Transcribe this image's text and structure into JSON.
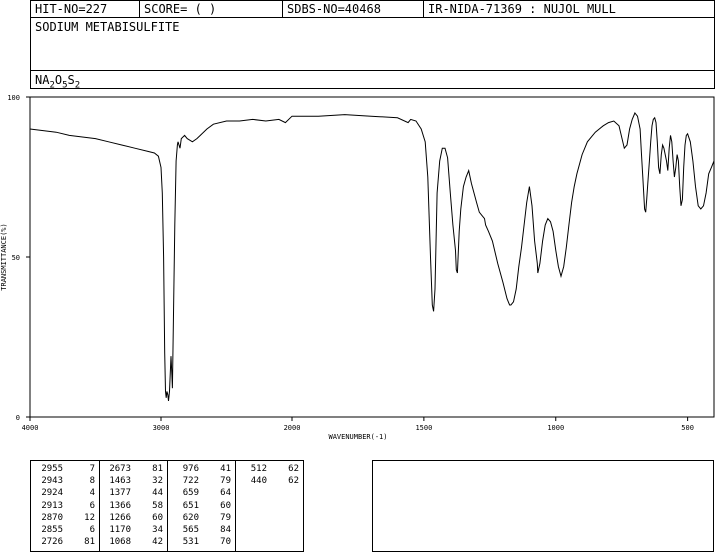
{
  "header": {
    "hit_no": "HIT-NO=227",
    "score": "SCORE=  (   )",
    "sdbs_no": "SDBS-NO=40468",
    "ir_nida": "IR-NIDA-71369 : NUJOL MULL"
  },
  "compound": {
    "name": "SODIUM METABISULFITE",
    "formula_parts": [
      "NA",
      "2",
      "O",
      "5",
      "S",
      "2"
    ]
  },
  "chart_data": {
    "type": "line",
    "xlabel": "WAVENUMBER(-1)",
    "ylabel": "TRANSMITTANCE(%)",
    "xlim": [
      4000,
      400
    ],
    "ylim": [
      0,
      100
    ],
    "x_ticks": [
      "4000",
      "3000",
      "2000",
      "1500",
      "1000",
      "500"
    ],
    "y_ticks": [
      "100",
      "50",
      "0"
    ],
    "grid": false,
    "series": [
      {
        "points": [
          [
            4000,
            90
          ],
          [
            3900,
            89.5
          ],
          [
            3800,
            89
          ],
          [
            3700,
            88
          ],
          [
            3600,
            87.5
          ],
          [
            3500,
            87
          ],
          [
            3400,
            86
          ],
          [
            3300,
            85
          ],
          [
            3200,
            84
          ],
          [
            3100,
            83
          ],
          [
            3050,
            82.5
          ],
          [
            3020,
            81.5
          ],
          [
            3000,
            78
          ],
          [
            2990,
            70
          ],
          [
            2980,
            50
          ],
          [
            2972,
            20
          ],
          [
            2966,
            8
          ],
          [
            2960,
            6
          ],
          [
            2955,
            8
          ],
          [
            2948,
            7
          ],
          [
            2943,
            5
          ],
          [
            2935,
            8
          ],
          [
            2924,
            19
          ],
          [
            2917,
            13
          ],
          [
            2913,
            9
          ],
          [
            2905,
            30
          ],
          [
            2895,
            60
          ],
          [
            2885,
            80
          ],
          [
            2875,
            85
          ],
          [
            2870,
            86
          ],
          [
            2855,
            84
          ],
          [
            2845,
            87
          ],
          [
            2820,
            88
          ],
          [
            2800,
            87
          ],
          [
            2760,
            86
          ],
          [
            2726,
            87
          ],
          [
            2700,
            88
          ],
          [
            2650,
            90
          ],
          [
            2600,
            91.5
          ],
          [
            2500,
            92.5
          ],
          [
            2400,
            92.5
          ],
          [
            2300,
            93
          ],
          [
            2200,
            92.5
          ],
          [
            2100,
            93
          ],
          [
            2050,
            92
          ],
          [
            2000,
            94
          ],
          [
            1900,
            94
          ],
          [
            1800,
            94.5
          ],
          [
            1700,
            94
          ],
          [
            1600,
            93.5
          ],
          [
            1560,
            92
          ],
          [
            1550,
            93
          ],
          [
            1530,
            92.5
          ],
          [
            1510,
            90
          ],
          [
            1495,
            86
          ],
          [
            1485,
            75
          ],
          [
            1475,
            50
          ],
          [
            1468,
            35
          ],
          [
            1463,
            33
          ],
          [
            1458,
            40
          ],
          [
            1450,
            70
          ],
          [
            1440,
            80
          ],
          [
            1430,
            84
          ],
          [
            1420,
            84
          ],
          [
            1410,
            81
          ],
          [
            1400,
            70
          ],
          [
            1390,
            60
          ],
          [
            1380,
            52
          ],
          [
            1377,
            46
          ],
          [
            1373,
            45
          ],
          [
            1366,
            58
          ],
          [
            1360,
            65
          ],
          [
            1350,
            72
          ],
          [
            1340,
            75
          ],
          [
            1330,
            77
          ],
          [
            1320,
            73
          ],
          [
            1310,
            70
          ],
          [
            1300,
            67
          ],
          [
            1290,
            64
          ],
          [
            1280,
            63
          ],
          [
            1270,
            62
          ],
          [
            1266,
            60
          ],
          [
            1255,
            58
          ],
          [
            1240,
            55
          ],
          [
            1220,
            48
          ],
          [
            1200,
            42
          ],
          [
            1185,
            37
          ],
          [
            1175,
            35
          ],
          [
            1170,
            35
          ],
          [
            1160,
            36
          ],
          [
            1150,
            40
          ],
          [
            1140,
            47
          ],
          [
            1130,
            53
          ],
          [
            1120,
            60
          ],
          [
            1110,
            67
          ],
          [
            1100,
            72
          ],
          [
            1090,
            66
          ],
          [
            1080,
            55
          ],
          [
            1070,
            48
          ],
          [
            1068,
            45
          ],
          [
            1060,
            48
          ],
          [
            1050,
            55
          ],
          [
            1040,
            60
          ],
          [
            1030,
            62
          ],
          [
            1020,
            61
          ],
          [
            1010,
            58
          ],
          [
            1000,
            52
          ],
          [
            990,
            47
          ],
          [
            980,
            44
          ],
          [
            970,
            47
          ],
          [
            960,
            53
          ],
          [
            950,
            60
          ],
          [
            940,
            67
          ],
          [
            930,
            72
          ],
          [
            920,
            76
          ],
          [
            900,
            82
          ],
          [
            880,
            86
          ],
          [
            850,
            89
          ],
          [
            820,
            91
          ],
          [
            800,
            92
          ],
          [
            780,
            92.5
          ],
          [
            760,
            91
          ],
          [
            740,
            84
          ],
          [
            730,
            85
          ],
          [
            720,
            90
          ],
          [
            710,
            93
          ],
          [
            700,
            95
          ],
          [
            690,
            94
          ],
          [
            680,
            90
          ],
          [
            675,
            82
          ],
          [
            670,
            75
          ],
          [
            663,
            65
          ],
          [
            659,
            64
          ],
          [
            655,
            68
          ],
          [
            651,
            73
          ],
          [
            645,
            80
          ],
          [
            640,
            86
          ],
          [
            635,
            91
          ],
          [
            630,
            93
          ],
          [
            625,
            93.5
          ],
          [
            620,
            92
          ],
          [
            615,
            86
          ],
          [
            610,
            78
          ],
          [
            605,
            76
          ],
          [
            600,
            82
          ],
          [
            595,
            85
          ],
          [
            590,
            84
          ],
          [
            580,
            80
          ],
          [
            575,
            77
          ],
          [
            570,
            84
          ],
          [
            565,
            88
          ],
          [
            560,
            86
          ],
          [
            555,
            80
          ],
          [
            550,
            75
          ],
          [
            545,
            78
          ],
          [
            540,
            82
          ],
          [
            535,
            80
          ],
          [
            530,
            72
          ],
          [
            525,
            66
          ],
          [
            520,
            68
          ],
          [
            515,
            78
          ],
          [
            510,
            85
          ],
          [
            505,
            88
          ],
          [
            500,
            88.5
          ],
          [
            490,
            86
          ],
          [
            480,
            80
          ],
          [
            470,
            72
          ],
          [
            460,
            66
          ],
          [
            450,
            65
          ],
          [
            440,
            66
          ],
          [
            430,
            70
          ],
          [
            420,
            76
          ],
          [
            410,
            78
          ],
          [
            400,
            80
          ]
        ]
      }
    ]
  },
  "peaks": [
    [
      [
        "2955",
        "7"
      ],
      [
        "2943",
        "8"
      ],
      [
        "2924",
        "4"
      ],
      [
        "2913",
        "6"
      ],
      [
        "2870",
        "12"
      ],
      [
        "2855",
        "6"
      ],
      [
        "2726",
        "81"
      ]
    ],
    [
      [
        "2673",
        "81"
      ],
      [
        "1463",
        "32"
      ],
      [
        "1377",
        "44"
      ],
      [
        "1366",
        "58"
      ],
      [
        "1266",
        "60"
      ],
      [
        "1170",
        "34"
      ],
      [
        "1068",
        "42"
      ]
    ],
    [
      [
        "976",
        "41"
      ],
      [
        "722",
        "79"
      ],
      [
        "659",
        "64"
      ],
      [
        "651",
        "60"
      ],
      [
        "620",
        "79"
      ],
      [
        "565",
        "84"
      ],
      [
        "531",
        "70"
      ]
    ],
    [
      [
        "512",
        "62"
      ],
      [
        "440",
        "62"
      ]
    ]
  ]
}
